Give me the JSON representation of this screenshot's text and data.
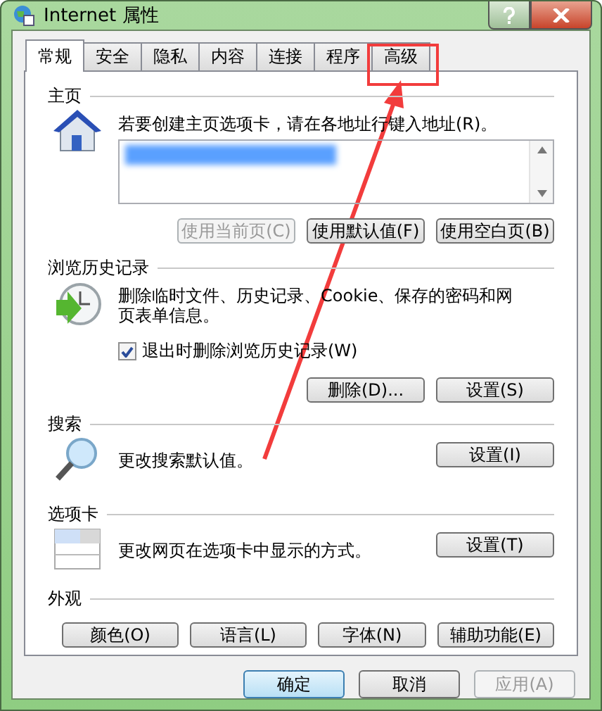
{
  "window": {
    "title": "Internet 属性"
  },
  "tabs": [
    {
      "label": "常规",
      "selected": true
    },
    {
      "label": "安全",
      "selected": false
    },
    {
      "label": "隐私",
      "selected": false
    },
    {
      "label": "内容",
      "selected": false
    },
    {
      "label": "连接",
      "selected": false
    },
    {
      "label": "程序",
      "selected": false
    },
    {
      "label": "高级",
      "selected": false
    }
  ],
  "home_page": {
    "heading": "主页",
    "description": "若要创建主页选项卡，请在各地址行键入地址(R)。",
    "buttons": [
      {
        "label": "使用当前页(C)",
        "disabled": true
      },
      {
        "label": "使用默认值(F)",
        "disabled": false
      },
      {
        "label": "使用空白页(B)",
        "disabled": false
      }
    ]
  },
  "browsing_history": {
    "heading": "浏览历史记录",
    "description": "删除临时文件、历史记录、Cookie、保存的密码和网页表单信息。",
    "checkbox": {
      "label": "退出时删除浏览历史记录(W)",
      "checked": true
    },
    "buttons": [
      {
        "label": "删除(D)...",
        "disabled": false
      },
      {
        "label": "设置(S)",
        "disabled": false
      }
    ]
  },
  "search": {
    "heading": "搜索",
    "description": "更改搜索默认值。",
    "button": "设置(I)"
  },
  "tabs_section": {
    "heading": "选项卡",
    "description": "更改网页在选项卡中显示的方式。",
    "button": "设置(T)"
  },
  "appearance": {
    "heading": "外观",
    "buttons": [
      "颜色(O)",
      "语言(L)",
      "字体(N)",
      "辅助功能(E)"
    ]
  },
  "footer_buttons": [
    {
      "label": "确定",
      "disabled": false,
      "default": true
    },
    {
      "label": "取消",
      "disabled": false,
      "default": false
    },
    {
      "label": "应用(A)",
      "disabled": true,
      "default": false
    }
  ]
}
